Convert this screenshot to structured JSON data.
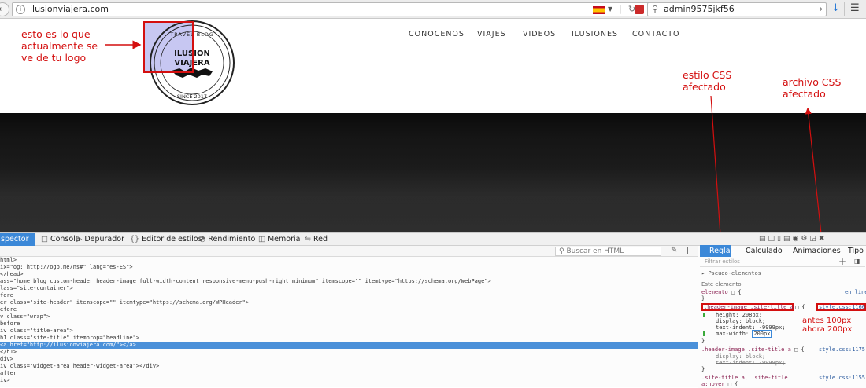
{
  "browser": {
    "url": "ilusionviajera.com",
    "search_value": "admin9575jkf56",
    "back_icon": "arrow-left",
    "info_icon": "i"
  },
  "site": {
    "nav": [
      "CONOCENOS",
      "VIAJES",
      "VIDEOS",
      "ILUSIONES",
      "CONTACTO"
    ],
    "logo": {
      "top": "TRAVEL BLOG",
      "line1": "ILUSION",
      "line2": "VIAJERA",
      "bottom": "SINCE 2017"
    }
  },
  "annotations": {
    "logo_note": "esto es lo que actualmente se ve de tu logo",
    "css_style": "estilo CSS afectado",
    "css_file": "archivo CSS afectado",
    "change_note_1": "antes 100px",
    "change_note_2": "ahora 200px",
    "color": "#d40f0f"
  },
  "devtools": {
    "tabs": [
      "spector",
      "Consola",
      "Depurador",
      "Editor de estilos",
      "Rendimiento",
      "Memoria",
      "Red"
    ],
    "search_placeholder": "Buscar en HTML",
    "markup_lines": [
      "html>",
      "ix=\"og: http://ogp.me/ns#\" lang=\"es-ES\">",
      "</head>",
      "ass=\"home blog custom-header header-image full-width-content responsive-menu-push-right minimum\" itemscope=\"\" itemtype=\"https://schema.org/WebPage\">",
      "lass=\"site-container\">",
      "fore",
      "er class=\"site-header\" itemscope=\"\" itemtype=\"https://schema.org/WPHeader\">",
      "efore",
      "v class=\"wrap\">",
      "before",
      "iv class=\"title-area\">",
      "h1 class=\"site-title\" itemprop=\"headline\">",
      "<a href=\"http://ilusionviajera.com/\"></a>",
      "</h1>",
      "div>",
      "iv class=\"widget-area header-widget-area\"></div>",
      "after",
      "iv>"
    ],
    "selected_line": 12,
    "side_tabs": [
      "Reglas",
      "Calculado",
      "Animaciones",
      "Tipo"
    ],
    "filter_placeholder": "Filtrar estilos",
    "pseudo": "Pseudo-elementos",
    "this_element": "Este elemento",
    "elemento_label": "elemento",
    "inline_label": "en línea",
    "rule1": {
      "selector": ".header-image .site-title a",
      "source": "style.css:1166",
      "props": [
        "height: 208px;",
        "display: block;",
        "text-indent: -9999px;",
        "max-width: 200px;"
      ],
      "edited_value": "200px"
    },
    "rule2": {
      "selector": ".header-image .site-title a",
      "source": "style.css:1175",
      "props": [
        "display: block;",
        "text-indent: -9999px;"
      ]
    },
    "rule3": {
      "selector": ".site-title a, .site-title",
      "selector2": "a:hover",
      "source": "style.css:1155"
    }
  }
}
